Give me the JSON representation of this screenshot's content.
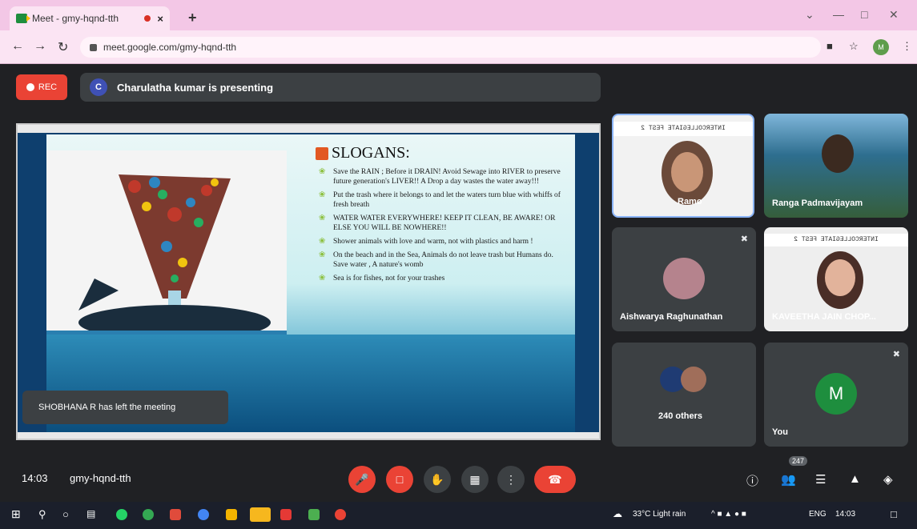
{
  "browser": {
    "tab_title": "Meet - gmy-hqnd-tth",
    "tab_close": "×",
    "new_tab": "+",
    "url": "meet.google.com/gmy-hqnd-tth",
    "profile_initials": "M"
  },
  "meet": {
    "rec_label": "REC",
    "presenter_initial": "C",
    "presenting_text": "Charulatha kumar is presenting",
    "toast": "SHOBHANA R has left the meeting",
    "slide": {
      "title": "SLOGANS:",
      "items": [
        "Save the RAIN ; Before it DRAIN! Avoid Sewage into RIVER to preserve future generation's LIVER!! A Drop a day wastes the water away!!!",
        "Put the trash where it belongs to and let the waters turn blue with whiffs of fresh breath",
        "WATER WATER EVERYWHERE! KEEP IT CLEAN, BE AWARE! OR ELSE YOU WILL BE NOWHERE!!",
        "Shower animals with love and warm, not with plastics and harm !",
        "On the beach and in the Sea, Animals do not leave trash but Humans do. Save water , A nature's womb",
        "Sea is for fishes, not for your trashes"
      ]
    },
    "participants": {
      "tile1_name": "Ramo",
      "tile1_banner": "INTERCOLLEGIATE FEST 2",
      "tile2_name": "Ranga Padmavijayam",
      "tile3_name": "Aishwarya Raghunathan",
      "tile4_name": "KAVEETHA JAIN CHOP...",
      "tile4_banner": "INTERCOLLEGIATE FEST 2",
      "tile5_name": "240 others",
      "tile6_name": "You",
      "tile6_initial": "M"
    }
  },
  "controls": {
    "time": "14:03",
    "meeting_code": "gmy-hqnd-tth",
    "participant_count": "247"
  },
  "taskbar": {
    "weather": "33°C Light rain",
    "lang": "ENG",
    "time": "14:03"
  },
  "colors": {
    "accent_red": "#ea4335",
    "tile_bg": "#3c4043",
    "self_avatar": "#1e8e3e"
  }
}
